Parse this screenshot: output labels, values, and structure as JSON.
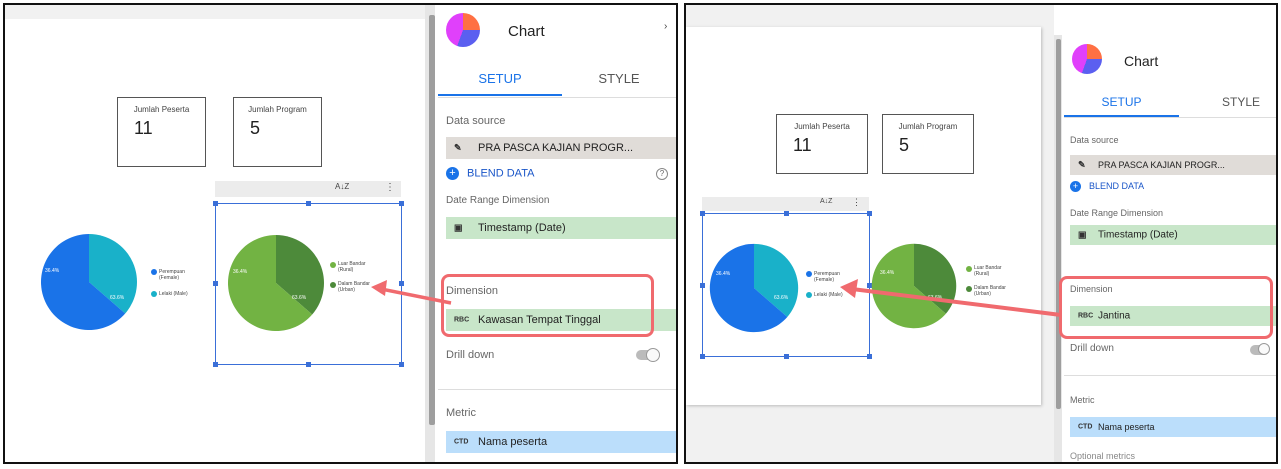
{
  "left": {
    "scorecards": [
      {
        "label": "Jumlah Peserta",
        "value": "11"
      },
      {
        "label": "Jumlah Program",
        "value": "5"
      }
    ],
    "pie_a": {
      "slices": [
        {
          "pct": 36.4,
          "label": "36.4%",
          "color": "#19b1c9"
        },
        {
          "pct": 63.6,
          "label": "63.6%",
          "color": "#1a73e8"
        }
      ],
      "legend": [
        "Perempuan (Female)",
        "Lelaki (Male)"
      ]
    },
    "pie_b": {
      "slices": [
        {
          "pct": 36.4,
          "label": "36.4%",
          "color": "#4d8a3a"
        },
        {
          "pct": 63.6,
          "label": "63.6%",
          "color": "#72b343"
        }
      ],
      "legend": [
        "Luar Bandar (Rural)",
        "Dalam Bandar (Urban)"
      ]
    },
    "toolbar": {
      "sort_icon": "A↓Z",
      "more_icon": "⋮"
    },
    "properties": {
      "title": "Chart",
      "tabs": [
        "SETUP",
        "STYLE"
      ],
      "data_source_label": "Data source",
      "data_source": "PRA PASCA KAJIAN PROGR...",
      "blend": "BLEND DATA",
      "help": "?",
      "date_range_label": "Date Range Dimension",
      "date_range": "Timestamp (Date)",
      "dimension_label": "Dimension",
      "dimension_type": "RBC",
      "dimension": "Kawasan Tempat Tinggal",
      "drill_down": "Drill down",
      "metric_label": "Metric",
      "metric_type": "CTD",
      "metric": "Nama peserta"
    }
  },
  "right": {
    "scorecards": [
      {
        "label": "Jumlah Peserta",
        "value": "11"
      },
      {
        "label": "Jumlah Program",
        "value": "5"
      }
    ],
    "pie_a": {
      "slices": [
        {
          "pct": 36.4,
          "label": "36.4%",
          "color": "#19b1c9"
        },
        {
          "pct": 63.6,
          "label": "63.6%",
          "color": "#1a73e8"
        }
      ],
      "legend": [
        "Perempuan (Female)",
        "Lelaki (Male)"
      ]
    },
    "pie_b": {
      "slices": [
        {
          "pct": 36.4,
          "label": "36.4%",
          "color": "#4d8a3a"
        },
        {
          "pct": 63.6,
          "label": "63.6%",
          "color": "#72b343"
        }
      ],
      "legend": [
        "Luar Bandar (Rural)",
        "Dalam Bandar (Urban)"
      ]
    },
    "toolbar": {
      "sort_icon": "A↓Z",
      "more_icon": "⋮"
    },
    "properties": {
      "title": "Chart",
      "tabs": [
        "SETUP",
        "STYLE"
      ],
      "data_source_label": "Data source",
      "data_source": "PRA PASCA KAJIAN PROGR...",
      "blend": "BLEND DATA",
      "date_range_label": "Date Range Dimension",
      "date_range": "Timestamp (Date)",
      "dimension_label": "Dimension",
      "dimension_type": "RBC",
      "dimension": "Jantina",
      "drill_down": "Drill down",
      "metric_label": "Metric",
      "metric_type": "CTD",
      "metric": "Nama peserta",
      "optional_metrics": "Optional metrics"
    }
  },
  "colors": {
    "accent": "#1a73e8",
    "callout": "#f06a6e",
    "field_green": "#c8e6c9",
    "field_blue": "#bbdefb"
  }
}
